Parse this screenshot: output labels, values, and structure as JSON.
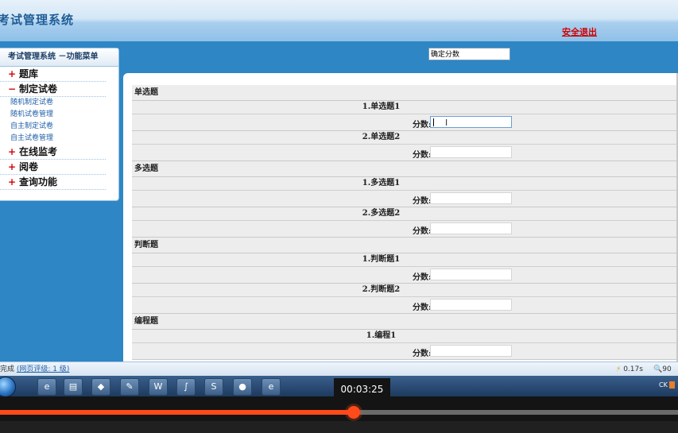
{
  "app": {
    "title": "考试管理系统",
    "logout": "安全退出"
  },
  "sidebar": {
    "header": "考试管理系统 －功能菜单",
    "menus": [
      {
        "sign": "+",
        "label": "题库"
      },
      {
        "sign": "−",
        "label": "制定试卷",
        "items": [
          "随机制定试卷",
          "随机试卷管理",
          "自主制定试卷",
          "自主试卷管理"
        ]
      },
      {
        "sign": "+",
        "label": "在线监考"
      },
      {
        "sign": "+",
        "label": "阅卷"
      },
      {
        "sign": "+",
        "label": "查询功能"
      }
    ]
  },
  "toolbar": {
    "confirm_value": "确定分数"
  },
  "score_label": "分数:",
  "sections": [
    {
      "title": "单选题",
      "questions": [
        "1.单选题1",
        "2.单选题2"
      ]
    },
    {
      "title": "多选题",
      "questions": [
        "1.多选题1",
        "2.多选题2"
      ]
    },
    {
      "title": "判断题",
      "questions": [
        "1.判断题1",
        "2.判断题2"
      ]
    },
    {
      "title": "编程题",
      "questions": [
        "1.编程1"
      ]
    }
  ],
  "status": {
    "done": "完成",
    "rating": "(网页评级: 1 级)",
    "speed": "0.17s",
    "zoom": "90"
  },
  "taskbar": {
    "tray_text": "CK"
  },
  "player": {
    "time": "00:03:25",
    "progress": 0.522
  },
  "colors": {
    "accent": "#2e86c4",
    "progress": "#ff4a1a",
    "logout": "#d00000"
  }
}
